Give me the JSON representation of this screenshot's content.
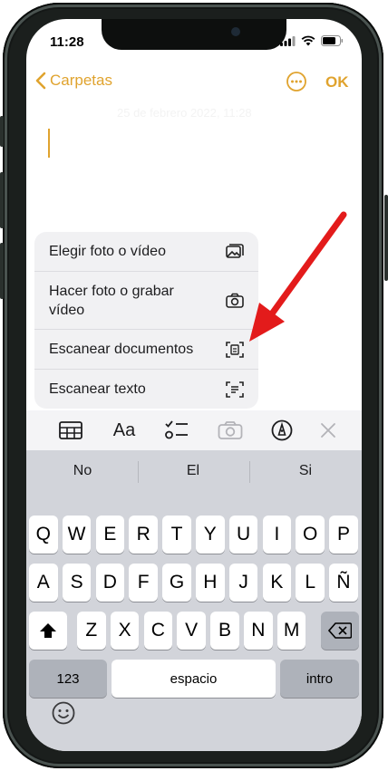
{
  "status": {
    "time": "11:28"
  },
  "nav": {
    "back_label": "Carpetas",
    "ok_label": "OK"
  },
  "note": {
    "date_faint": "25 de febrero 2022, 11:28"
  },
  "menu": {
    "items": [
      {
        "label": "Elegir foto o vídeo",
        "icon": "photo-icon"
      },
      {
        "label": "Hacer foto o grabar vídeo",
        "icon": "camera-icon"
      },
      {
        "label": "Escanear documentos",
        "icon": "doc-scan-icon"
      },
      {
        "label": "Escanear texto",
        "icon": "text-scan-icon"
      }
    ]
  },
  "toolbar": {
    "icons": [
      "table-icon",
      "format-text-icon",
      "checklist-icon",
      "camera-icon",
      "markup-pen-icon",
      "close-icon"
    ],
    "format_label": "Aa"
  },
  "suggestions": [
    "No",
    "El",
    "Si"
  ],
  "keyboard": {
    "row1": [
      "Q",
      "W",
      "E",
      "R",
      "T",
      "Y",
      "U",
      "I",
      "O",
      "P"
    ],
    "row2": [
      "A",
      "S",
      "D",
      "F",
      "G",
      "H",
      "J",
      "K",
      "L",
      "Ñ"
    ],
    "row3": [
      "Z",
      "X",
      "C",
      "V",
      "B",
      "N",
      "M"
    ],
    "numbers_label": "123",
    "space_label": "espacio",
    "return_label": "intro"
  },
  "colors": {
    "accent": "#e0a32e",
    "arrow": "#e31b1b"
  }
}
